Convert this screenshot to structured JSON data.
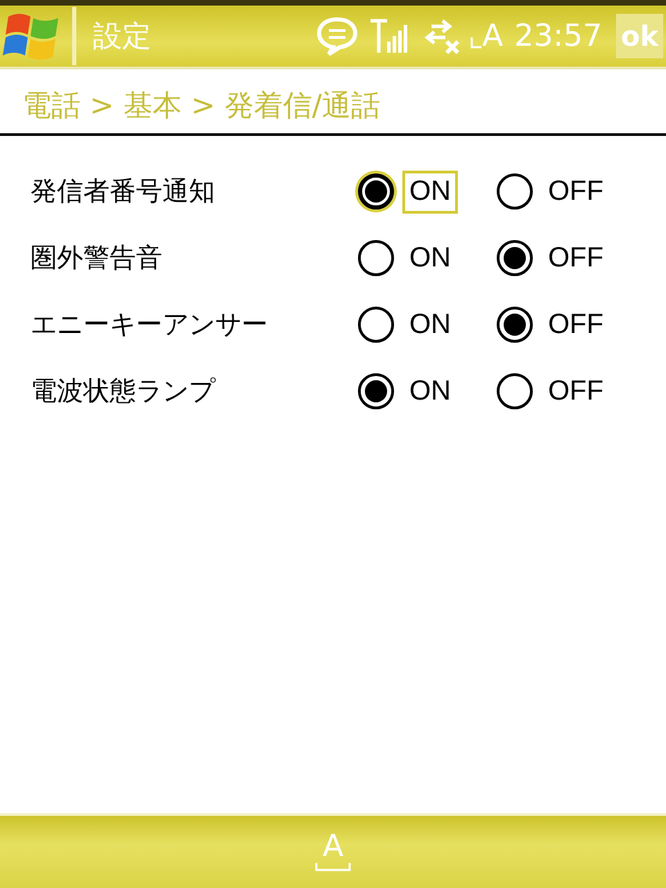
{
  "title_bar": {
    "title": "設定",
    "input_mode": "A",
    "clock": "23:57",
    "ok_button": "ok"
  },
  "breadcrumb": "電話 > 基本 > 発着信/通話",
  "settings": [
    {
      "label": "発信者番号通知",
      "options": [
        {
          "label": "ON",
          "selected": true,
          "focused": true
        },
        {
          "label": "OFF",
          "selected": false,
          "focused": false
        }
      ]
    },
    {
      "label": "圏外警告音",
      "options": [
        {
          "label": "ON",
          "selected": false,
          "focused": false
        },
        {
          "label": "OFF",
          "selected": true,
          "focused": false
        }
      ]
    },
    {
      "label": "エニーキーアンサー",
      "options": [
        {
          "label": "ON",
          "selected": false,
          "focused": false
        },
        {
          "label": "OFF",
          "selected": true,
          "focused": false
        }
      ]
    },
    {
      "label": "電波状態ランプ",
      "options": [
        {
          "label": "ON",
          "selected": true,
          "focused": false
        },
        {
          "label": "OFF",
          "selected": false,
          "focused": false
        }
      ]
    }
  ],
  "bottom_bar": {
    "keyboard": "A"
  }
}
